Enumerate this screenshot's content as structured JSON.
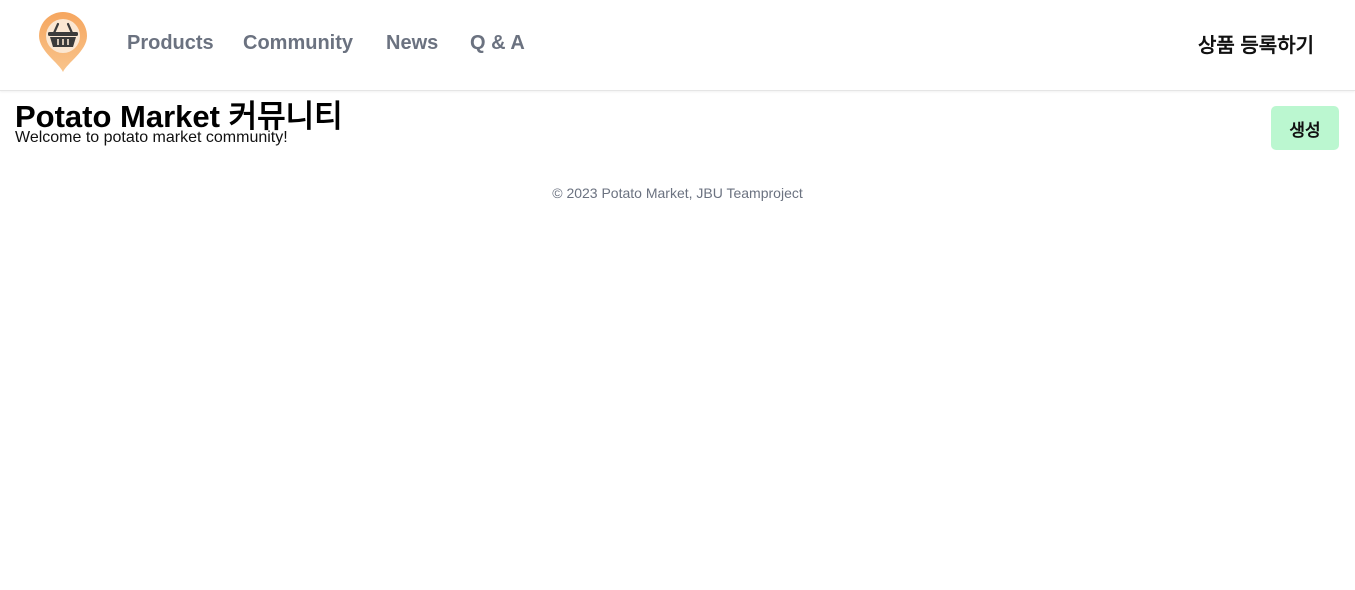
{
  "header": {
    "logo_icon": "shopping-basket-location-pin-icon",
    "brand_color": "#f5a25d",
    "nav": [
      {
        "label": "Products"
      },
      {
        "label": "Community"
      },
      {
        "label": "News"
      },
      {
        "label": "Q & A"
      }
    ],
    "register_label": "상품 등록하기"
  },
  "main": {
    "title": "Potato Market 커뮤니티",
    "subtitle": "Welcome to potato market community!",
    "create_button_label": "생성",
    "create_button_color": "#bbf7d0"
  },
  "footer": {
    "copyright": "© 2023 Potato Market, JBU Teamproject"
  }
}
